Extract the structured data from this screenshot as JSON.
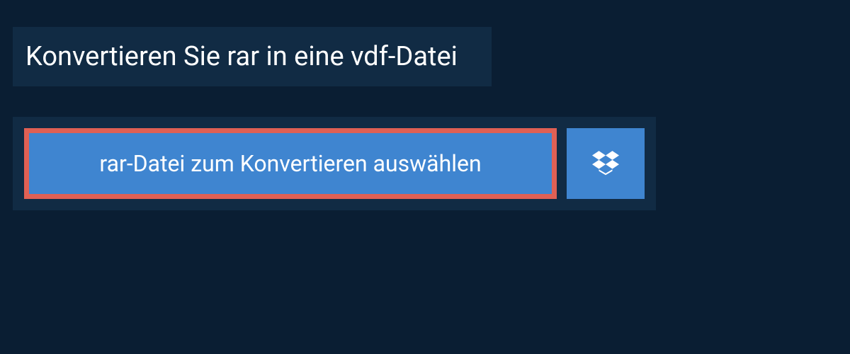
{
  "heading": "Konvertieren Sie rar in eine vdf-Datei",
  "picker": {
    "select_label": "rar-Datei zum Konvertieren auswählen"
  }
}
